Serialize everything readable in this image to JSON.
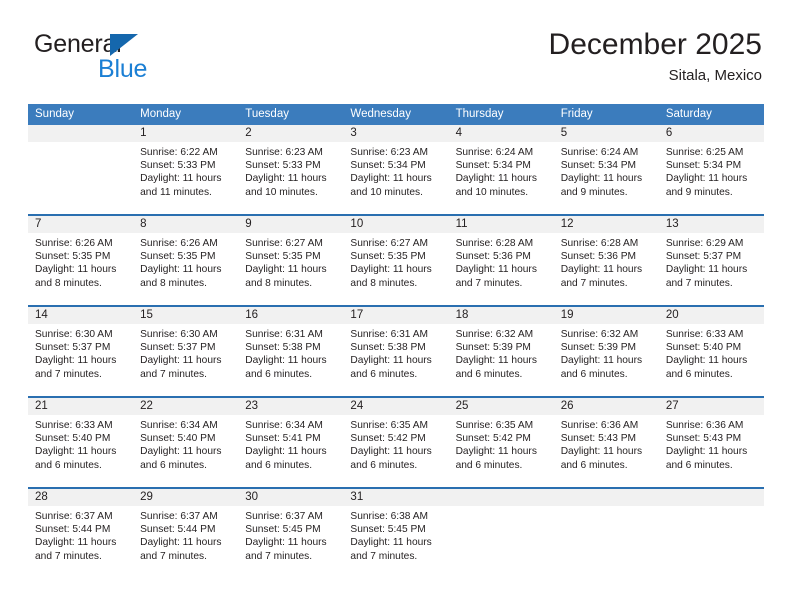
{
  "brand": {
    "word_one": "General",
    "word_two": "Blue",
    "triangle_icon": "triangle-icon",
    "accent_dark": "#1567ad",
    "accent_light": "#1b7fd4"
  },
  "header": {
    "title": "December 2025",
    "subtitle": "Sitala, Mexico",
    "header_bg": "#3b7cbd",
    "rule_color": "#2a6fb0",
    "daynum_band": "#f1f1f1"
  },
  "weekdays": [
    "Sunday",
    "Monday",
    "Tuesday",
    "Wednesday",
    "Thursday",
    "Friday",
    "Saturday"
  ],
  "weeks": [
    [
      {
        "day": "",
        "lines": []
      },
      {
        "day": "1",
        "lines": [
          "Sunrise: 6:22 AM",
          "Sunset: 5:33 PM",
          "Daylight: 11 hours",
          "and 11 minutes."
        ]
      },
      {
        "day": "2",
        "lines": [
          "Sunrise: 6:23 AM",
          "Sunset: 5:33 PM",
          "Daylight: 11 hours",
          "and 10 minutes."
        ]
      },
      {
        "day": "3",
        "lines": [
          "Sunrise: 6:23 AM",
          "Sunset: 5:34 PM",
          "Daylight: 11 hours",
          "and 10 minutes."
        ]
      },
      {
        "day": "4",
        "lines": [
          "Sunrise: 6:24 AM",
          "Sunset: 5:34 PM",
          "Daylight: 11 hours",
          "and 10 minutes."
        ]
      },
      {
        "day": "5",
        "lines": [
          "Sunrise: 6:24 AM",
          "Sunset: 5:34 PM",
          "Daylight: 11 hours",
          "and 9 minutes."
        ]
      },
      {
        "day": "6",
        "lines": [
          "Sunrise: 6:25 AM",
          "Sunset: 5:34 PM",
          "Daylight: 11 hours",
          "and 9 minutes."
        ]
      }
    ],
    [
      {
        "day": "7",
        "lines": [
          "Sunrise: 6:26 AM",
          "Sunset: 5:35 PM",
          "Daylight: 11 hours",
          "and 8 minutes."
        ]
      },
      {
        "day": "8",
        "lines": [
          "Sunrise: 6:26 AM",
          "Sunset: 5:35 PM",
          "Daylight: 11 hours",
          "and 8 minutes."
        ]
      },
      {
        "day": "9",
        "lines": [
          "Sunrise: 6:27 AM",
          "Sunset: 5:35 PM",
          "Daylight: 11 hours",
          "and 8 minutes."
        ]
      },
      {
        "day": "10",
        "lines": [
          "Sunrise: 6:27 AM",
          "Sunset: 5:35 PM",
          "Daylight: 11 hours",
          "and 8 minutes."
        ]
      },
      {
        "day": "11",
        "lines": [
          "Sunrise: 6:28 AM",
          "Sunset: 5:36 PM",
          "Daylight: 11 hours",
          "and 7 minutes."
        ]
      },
      {
        "day": "12",
        "lines": [
          "Sunrise: 6:28 AM",
          "Sunset: 5:36 PM",
          "Daylight: 11 hours",
          "and 7 minutes."
        ]
      },
      {
        "day": "13",
        "lines": [
          "Sunrise: 6:29 AM",
          "Sunset: 5:37 PM",
          "Daylight: 11 hours",
          "and 7 minutes."
        ]
      }
    ],
    [
      {
        "day": "14",
        "lines": [
          "Sunrise: 6:30 AM",
          "Sunset: 5:37 PM",
          "Daylight: 11 hours",
          "and 7 minutes."
        ]
      },
      {
        "day": "15",
        "lines": [
          "Sunrise: 6:30 AM",
          "Sunset: 5:37 PM",
          "Daylight: 11 hours",
          "and 7 minutes."
        ]
      },
      {
        "day": "16",
        "lines": [
          "Sunrise: 6:31 AM",
          "Sunset: 5:38 PM",
          "Daylight: 11 hours",
          "and 6 minutes."
        ]
      },
      {
        "day": "17",
        "lines": [
          "Sunrise: 6:31 AM",
          "Sunset: 5:38 PM",
          "Daylight: 11 hours",
          "and 6 minutes."
        ]
      },
      {
        "day": "18",
        "lines": [
          "Sunrise: 6:32 AM",
          "Sunset: 5:39 PM",
          "Daylight: 11 hours",
          "and 6 minutes."
        ]
      },
      {
        "day": "19",
        "lines": [
          "Sunrise: 6:32 AM",
          "Sunset: 5:39 PM",
          "Daylight: 11 hours",
          "and 6 minutes."
        ]
      },
      {
        "day": "20",
        "lines": [
          "Sunrise: 6:33 AM",
          "Sunset: 5:40 PM",
          "Daylight: 11 hours",
          "and 6 minutes."
        ]
      }
    ],
    [
      {
        "day": "21",
        "lines": [
          "Sunrise: 6:33 AM",
          "Sunset: 5:40 PM",
          "Daylight: 11 hours",
          "and 6 minutes."
        ]
      },
      {
        "day": "22",
        "lines": [
          "Sunrise: 6:34 AM",
          "Sunset: 5:40 PM",
          "Daylight: 11 hours",
          "and 6 minutes."
        ]
      },
      {
        "day": "23",
        "lines": [
          "Sunrise: 6:34 AM",
          "Sunset: 5:41 PM",
          "Daylight: 11 hours",
          "and 6 minutes."
        ]
      },
      {
        "day": "24",
        "lines": [
          "Sunrise: 6:35 AM",
          "Sunset: 5:42 PM",
          "Daylight: 11 hours",
          "and 6 minutes."
        ]
      },
      {
        "day": "25",
        "lines": [
          "Sunrise: 6:35 AM",
          "Sunset: 5:42 PM",
          "Daylight: 11 hours",
          "and 6 minutes."
        ]
      },
      {
        "day": "26",
        "lines": [
          "Sunrise: 6:36 AM",
          "Sunset: 5:43 PM",
          "Daylight: 11 hours",
          "and 6 minutes."
        ]
      },
      {
        "day": "27",
        "lines": [
          "Sunrise: 6:36 AM",
          "Sunset: 5:43 PM",
          "Daylight: 11 hours",
          "and 6 minutes."
        ]
      }
    ],
    [
      {
        "day": "28",
        "lines": [
          "Sunrise: 6:37 AM",
          "Sunset: 5:44 PM",
          "Daylight: 11 hours",
          "and 7 minutes."
        ]
      },
      {
        "day": "29",
        "lines": [
          "Sunrise: 6:37 AM",
          "Sunset: 5:44 PM",
          "Daylight: 11 hours",
          "and 7 minutes."
        ]
      },
      {
        "day": "30",
        "lines": [
          "Sunrise: 6:37 AM",
          "Sunset: 5:45 PM",
          "Daylight: 11 hours",
          "and 7 minutes."
        ]
      },
      {
        "day": "31",
        "lines": [
          "Sunrise: 6:38 AM",
          "Sunset: 5:45 PM",
          "Daylight: 11 hours",
          "and 7 minutes."
        ]
      },
      {
        "day": "",
        "lines": []
      },
      {
        "day": "",
        "lines": []
      },
      {
        "day": "",
        "lines": []
      }
    ]
  ]
}
